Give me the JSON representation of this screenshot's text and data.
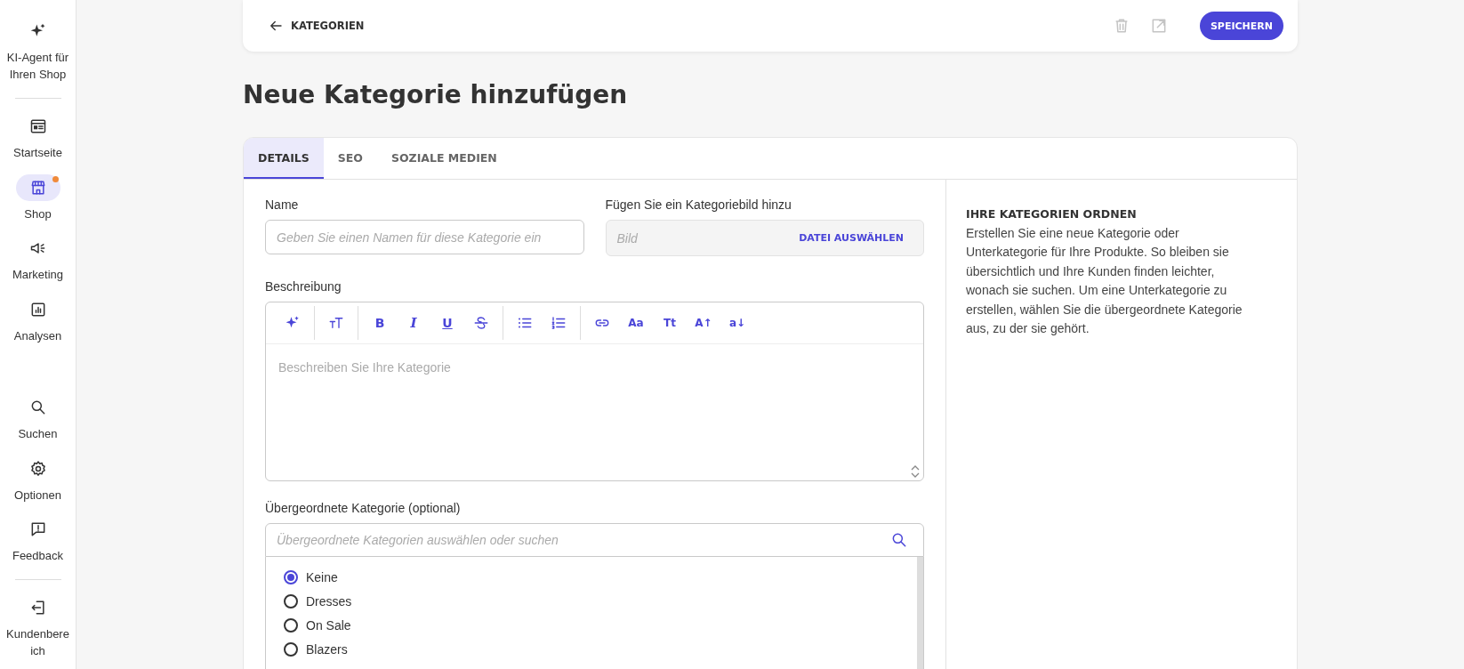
{
  "sidebar": {
    "top": [
      {
        "kind": "ai",
        "label": "KI-Agent für Ihren Shop",
        "selected": false,
        "badge": false
      },
      {
        "kind": "home",
        "label": "Startseite",
        "selected": false,
        "badge": false
      },
      {
        "kind": "shop",
        "label": "Shop",
        "selected": true,
        "badge": true
      },
      {
        "kind": "marketing",
        "label": "Marketing",
        "selected": false,
        "badge": false
      },
      {
        "kind": "analytics",
        "label": "Analysen",
        "selected": false,
        "badge": false
      }
    ],
    "bottom": [
      {
        "kind": "search",
        "label": "Suchen",
        "selected": false,
        "badge": false
      },
      {
        "kind": "settings",
        "label": "Optionen",
        "selected": false,
        "badge": false
      },
      {
        "kind": "feedback",
        "label": "Feedback",
        "selected": false,
        "badge": false
      },
      {
        "kind": "logout",
        "label": "Kundenbereich",
        "selected": false,
        "badge": false
      }
    ]
  },
  "top_bar": {
    "back_link": "KATEGORIEN",
    "actions": [
      {
        "kind": "delete",
        "disabled": true
      },
      {
        "kind": "open",
        "disabled": true
      }
    ],
    "save_button": "SPEICHERN"
  },
  "page_title": "Neue Kategorie hinzufügen",
  "tabs": [
    {
      "label": "DETAILS",
      "selected": true
    },
    {
      "label": "SEO",
      "selected": false
    },
    {
      "label": "SOZIALE MEDIEN",
      "selected": false
    }
  ],
  "form": {
    "name": {
      "label": "Name",
      "placeholder": "Geben Sie einen Namen für diese Kategorie ein"
    },
    "image": {
      "label": "Fügen Sie ein Kategoriebild hinzu",
      "placeholder": "Bild",
      "button": "DATEI AUSWÄHLEN"
    },
    "description": {
      "label": "Beschreibung",
      "placeholder": "Beschreiben Sie Ihre Kategorie",
      "toolbar": [
        [
          {
            "kind": "ai"
          }
        ],
        [
          {
            "kind": "text-size"
          }
        ],
        [
          {
            "kind": "bold",
            "label": "B"
          },
          {
            "kind": "italic",
            "label": "I"
          },
          {
            "kind": "underline",
            "label": "U"
          },
          {
            "kind": "strikethrough"
          }
        ],
        [
          {
            "kind": "bullet-list"
          },
          {
            "kind": "numbered-list"
          }
        ],
        [
          {
            "kind": "link"
          },
          {
            "kind": "text",
            "label": "Aa"
          },
          {
            "kind": "text",
            "label": "Tt"
          },
          {
            "kind": "text",
            "label": "A↑"
          },
          {
            "kind": "text",
            "label": "a↓"
          }
        ]
      ]
    },
    "parent": {
      "label": "Übergeordnete Kategorie (optional)",
      "placeholder": "Übergeordnete Kategorien auswählen oder suchen",
      "options": [
        {
          "label": "Keine",
          "selected": true
        },
        {
          "label": "Dresses",
          "selected": false
        },
        {
          "label": "On Sale",
          "selected": false
        },
        {
          "label": "Blazers",
          "selected": false
        }
      ]
    }
  },
  "help": {
    "title": "IHRE KATEGORIEN ORDNEN",
    "text": "Erstellen Sie eine neue Kategorie oder Unterkategorie für Ihre Produkte. So bleiben sie übersichtlich und Ihre Kunden finden leichter, wonach sie suchen. Um eine Unterkategorie zu erstellen, wählen Sie die übergeordnete Kategorie aus, zu der sie gehört."
  }
}
